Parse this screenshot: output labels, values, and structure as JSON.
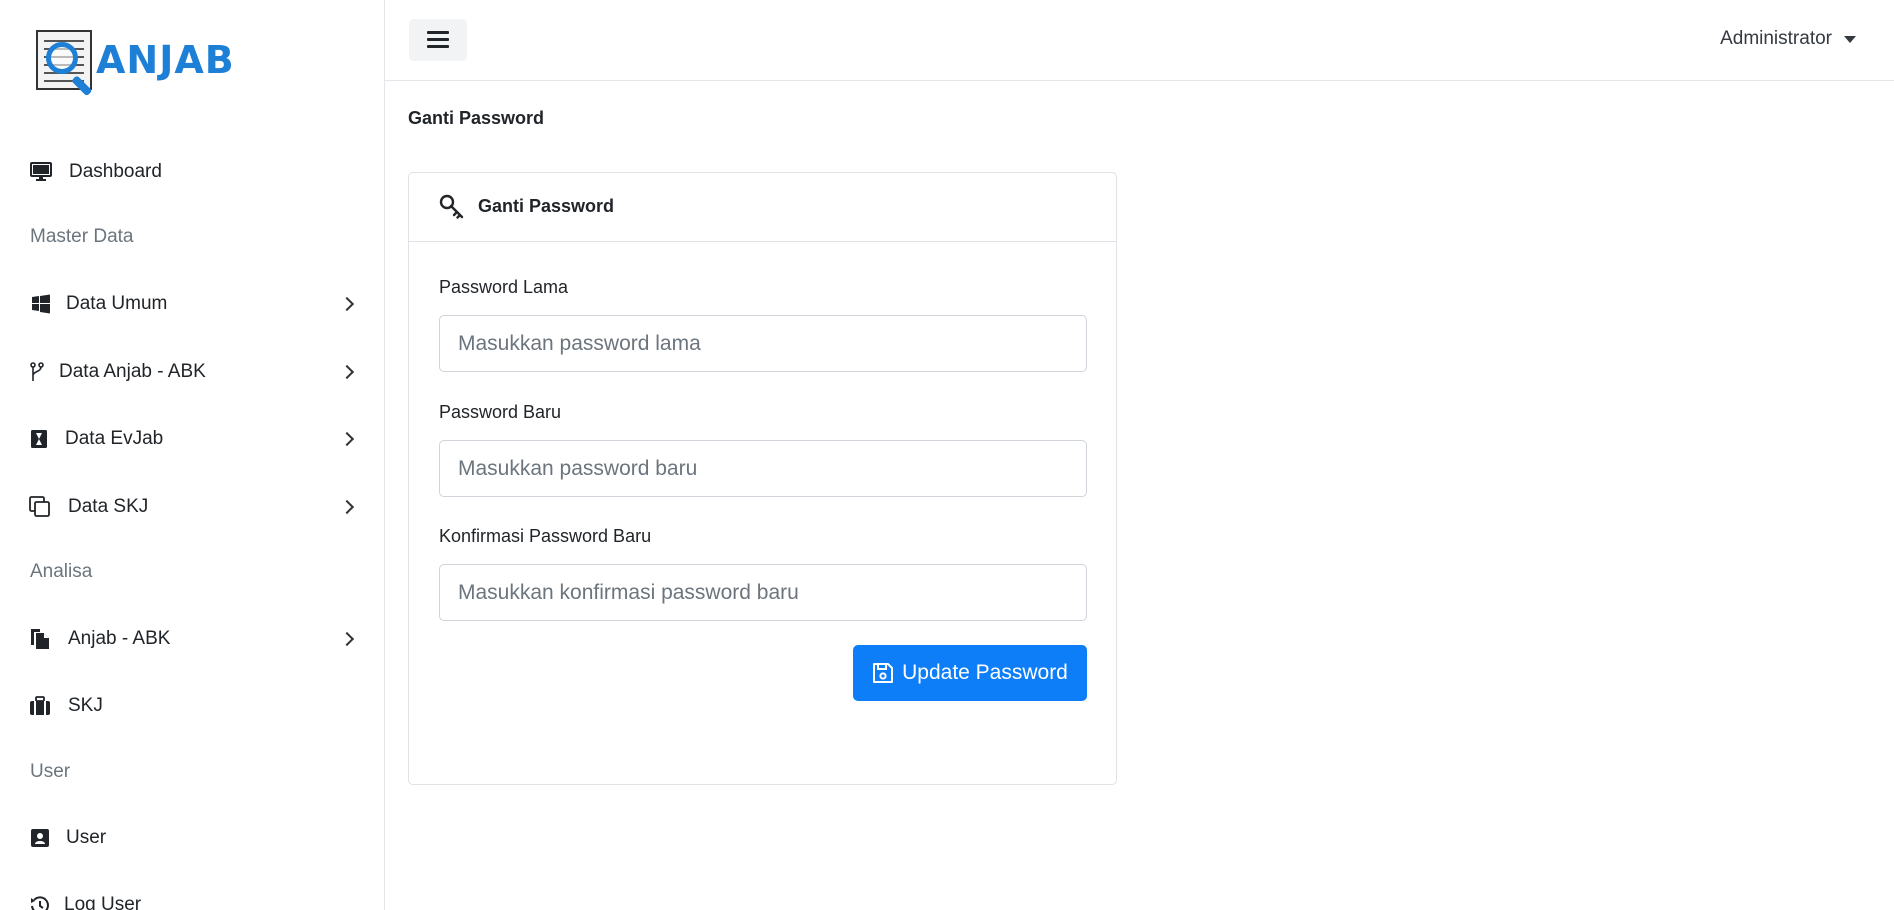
{
  "app": {
    "logo_text": "ANJAB"
  },
  "sidebar": {
    "dashboard": "Dashboard",
    "sections": {
      "master_data": "Master Data",
      "analisa": "Analisa",
      "user": "User"
    },
    "items": {
      "data_umum": "Data Umum",
      "data_anjab_abk": "Data Anjab - ABK",
      "data_evjab": "Data EvJab",
      "data_skj": "Data SKJ",
      "anjab_abk": "Anjab - ABK",
      "skj": "SKJ",
      "user": "User",
      "log_user": "Log User"
    }
  },
  "topbar": {
    "user_name": "Administrator"
  },
  "page": {
    "title": "Ganti Password"
  },
  "card": {
    "title": "Ganti Password",
    "fields": {
      "old": {
        "label": "Password Lama",
        "placeholder": "Masukkan password lama",
        "value": ""
      },
      "new": {
        "label": "Password Baru",
        "placeholder": "Masukkan password baru",
        "value": ""
      },
      "confirm": {
        "label": "Konfirmasi Password Baru",
        "placeholder": "Masukkan konfirmasi password baru",
        "value": ""
      }
    },
    "submit_label": "Update Password"
  },
  "colors": {
    "primary": "#0d7ef7",
    "logo_blue": "#1e7fd6",
    "muted": "#6c757d",
    "border": "#dfe3e7"
  },
  "icons": {
    "dashboard": "monitor-icon",
    "data_umum": "windows-icon",
    "data_anjab_abk": "git-branch-icon",
    "data_evjab": "hourglass-icon",
    "data_skj": "copy-icon",
    "anjab_abk": "files-icon",
    "skj": "briefcase-icon",
    "user": "contact-book-icon",
    "log_user": "history-icon",
    "card_header": "key-icon",
    "submit": "save-icon"
  }
}
